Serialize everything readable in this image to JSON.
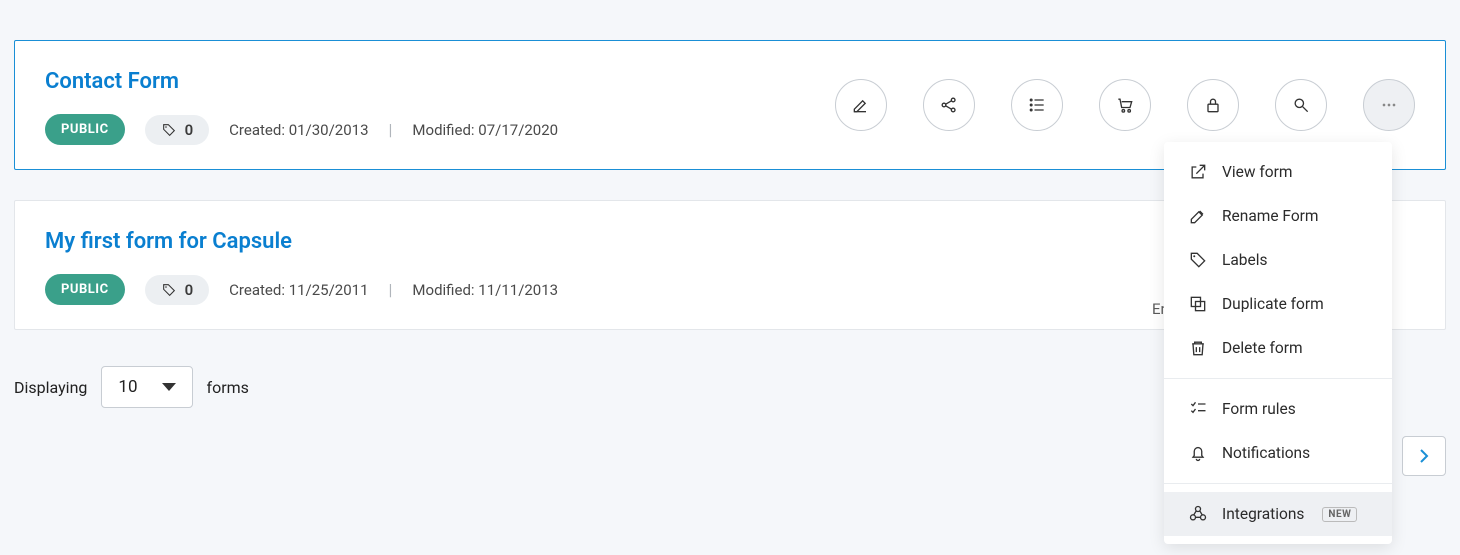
{
  "forms": [
    {
      "title": "Contact Form",
      "visibility": "PUBLIC",
      "label_count": "0",
      "created_label": "Created:",
      "created_date": "01/30/2013",
      "modified_label": "Modified:",
      "modified_date": "07/17/2020"
    },
    {
      "title": "My first form for Capsule",
      "visibility": "PUBLIC",
      "label_count": "0",
      "created_label": "Created:",
      "created_date": "11/25/2011",
      "modified_label": "Modified:",
      "modified_date": "11/11/2013"
    }
  ],
  "enabled_hint": "En",
  "pagination": {
    "displaying": "Displaying",
    "per_page": "10",
    "forms_label": "forms"
  },
  "menu": {
    "view": "View form",
    "rename": "Rename Form",
    "labels": "Labels",
    "duplicate": "Duplicate form",
    "delete": "Delete form",
    "rules": "Form rules",
    "notifications": "Notifications",
    "integrations": "Integrations",
    "new_badge": "NEW"
  }
}
